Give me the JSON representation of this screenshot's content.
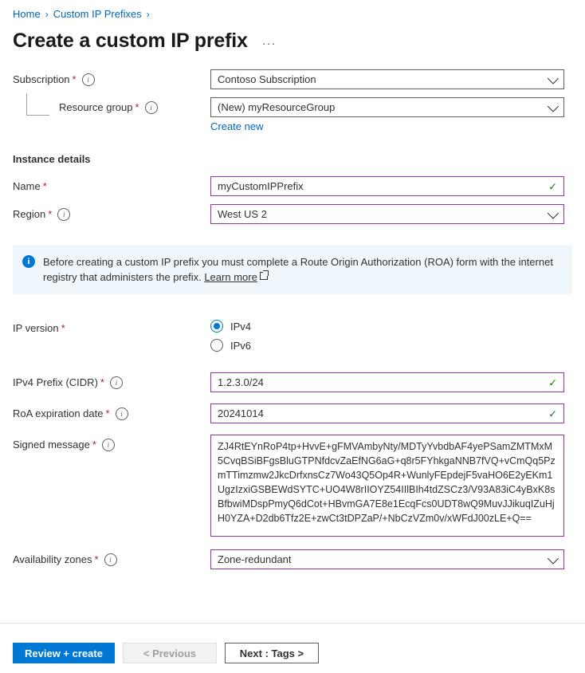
{
  "breadcrumb": {
    "items": [
      {
        "label": "Home"
      },
      {
        "label": "Custom IP Prefixes"
      }
    ],
    "separator": "›"
  },
  "header": {
    "title": "Create a custom IP prefix",
    "more_label": "···"
  },
  "form": {
    "subscription": {
      "label": "Subscription",
      "required": "*",
      "value": "Contoso Subscription"
    },
    "resource_group": {
      "label": "Resource group",
      "required": "*",
      "value": "(New) myResourceGroup",
      "create_new_label": "Create new"
    },
    "instance_details_heading": "Instance details",
    "name": {
      "label": "Name",
      "required": "*",
      "value": "myCustomIPPrefix"
    },
    "region": {
      "label": "Region",
      "required": "*",
      "value": "West US 2"
    },
    "banner": {
      "text": "Before creating a custom IP prefix you must complete a Route Origin Authorization (ROA) form with the internet registry that administers the prefix.",
      "link_label": "Learn more",
      "icon": "info-icon"
    },
    "ip_version": {
      "label": "IP version",
      "required": "*",
      "options": [
        {
          "label": "IPv4",
          "selected": true
        },
        {
          "label": "IPv6",
          "selected": false
        }
      ]
    },
    "ipv4_prefix": {
      "label": "IPv4 Prefix (CIDR)",
      "required": "*",
      "value": "1.2.3.0/24"
    },
    "roa_expiration": {
      "label": "RoA expiration date",
      "required": "*",
      "value": "20241014"
    },
    "signed_message": {
      "label": "Signed message",
      "required": "*",
      "value": "ZJ4RtEYnRoP4tp+HvvE+gFMVAmbyNty/MDTyYvbdbAF4yePSamZMTMxM5CvqBSiBFgsBluGTPNfdcvZaEfNG6aG+q8r5FYhkgaNNB7fVQ+vCmQq5PzmTTimzmw2JkcDrfxnsCz7Wo43Q5Op4R+WunlyFEpdejF5vaHO6E2yEKm1UgzIzxiGSBEWdSYTC+UO4W8rIIOYZ54IIlBIh4tdZSCz3/V93A83iC4yBxK8sBfbwiMDspPmyQ6dCot+HBvmGA7E8e1EcqFcs0UDT8wQ9MuvJJikuqIZuHjH0YZA+D2db6Tfz2E+zwCt3tDPZaP/+NbCzVZm0v/xWFdJ00zLE+Q=="
    },
    "availability_zones": {
      "label": "Availability zones",
      "required": "*",
      "value": "Zone-redundant"
    }
  },
  "footer": {
    "review_create": "Review + create",
    "previous": "< Previous",
    "next": "Next : Tags >"
  },
  "colors": {
    "accent_blue": "#0078d4",
    "link_blue": "#0067b8",
    "required_red": "#a4262c",
    "valid_green": "#107c10",
    "field_purple": "#9333a8",
    "banner_bg": "#eff6fc"
  }
}
